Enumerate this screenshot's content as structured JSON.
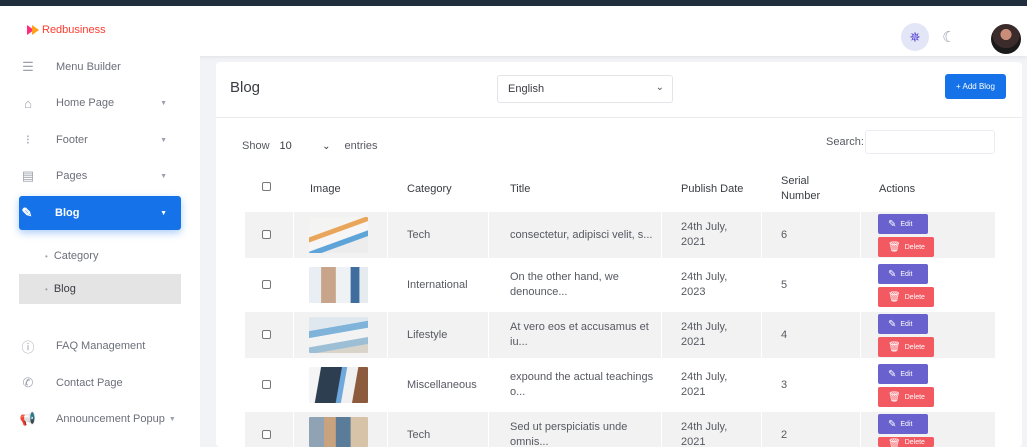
{
  "brand": {
    "name": "Redbusiness"
  },
  "header": {
    "theme_light_icon": "sun-icon",
    "theme_dark_icon": "moon-icon"
  },
  "sidebar": {
    "items": [
      {
        "label": "Menu Builder",
        "icon": "menu-icon"
      },
      {
        "label": "Home Page",
        "icon": "home-icon",
        "caret": "▼"
      },
      {
        "label": "Footer",
        "icon": "footer-icon",
        "caret": "▼"
      },
      {
        "label": "Pages",
        "icon": "file-icon",
        "caret": "▼"
      },
      {
        "label": "Blog",
        "icon": "blog-icon",
        "caret": "▼",
        "active": true
      },
      {
        "label": "FAQ Management",
        "icon": "question-icon"
      },
      {
        "label": "Contact Page",
        "icon": "whatsapp-icon"
      },
      {
        "label": "Announcement Popup",
        "icon": "megaphone-icon",
        "caret": "▼"
      }
    ],
    "blog_sub": [
      {
        "label": "Category"
      },
      {
        "label": "Blog",
        "active": true
      }
    ]
  },
  "card": {
    "title": "Blog",
    "language": "English",
    "add_button": "+ Add Blog",
    "show_label": "Show",
    "entries_value": "10",
    "entries_label": "entries",
    "search_label": "Search:"
  },
  "table": {
    "columns": [
      "Image",
      "Category",
      "Title",
      "Publish Date",
      "Serial Number",
      "Actions"
    ],
    "edit_label": "Edit",
    "delete_label": "Delete",
    "rows": [
      {
        "category": "Tech",
        "title": "consectetur, adipisci velit, s...",
        "date_1": "24th July,",
        "date_2": "2021",
        "serial": "6"
      },
      {
        "category": "International",
        "title_1": "On the other hand, we",
        "title_2": "denounce...",
        "date_1": "24th July,",
        "date_2": "2023",
        "serial": "5"
      },
      {
        "category": "Lifestyle",
        "title_1": "At vero eos et accusamus et",
        "title_2": "iu...",
        "date_1": "24th July,",
        "date_2": "2021",
        "serial": "4"
      },
      {
        "category": "Miscellaneous",
        "title_1": "expound the actual teachings",
        "title_2": "o...",
        "date_1": "24th July,",
        "date_2": "2021",
        "serial": "3"
      },
      {
        "category": "Tech",
        "title_1": "Sed ut perspiciatis unde",
        "title_2": "omnis...",
        "date_1": "24th July,",
        "date_2": "2021",
        "serial": "2"
      }
    ]
  },
  "colors": {
    "primary": "#1572e8",
    "edit": "#6861ce",
    "delete": "#f25961",
    "brand": "#ff3b30"
  }
}
